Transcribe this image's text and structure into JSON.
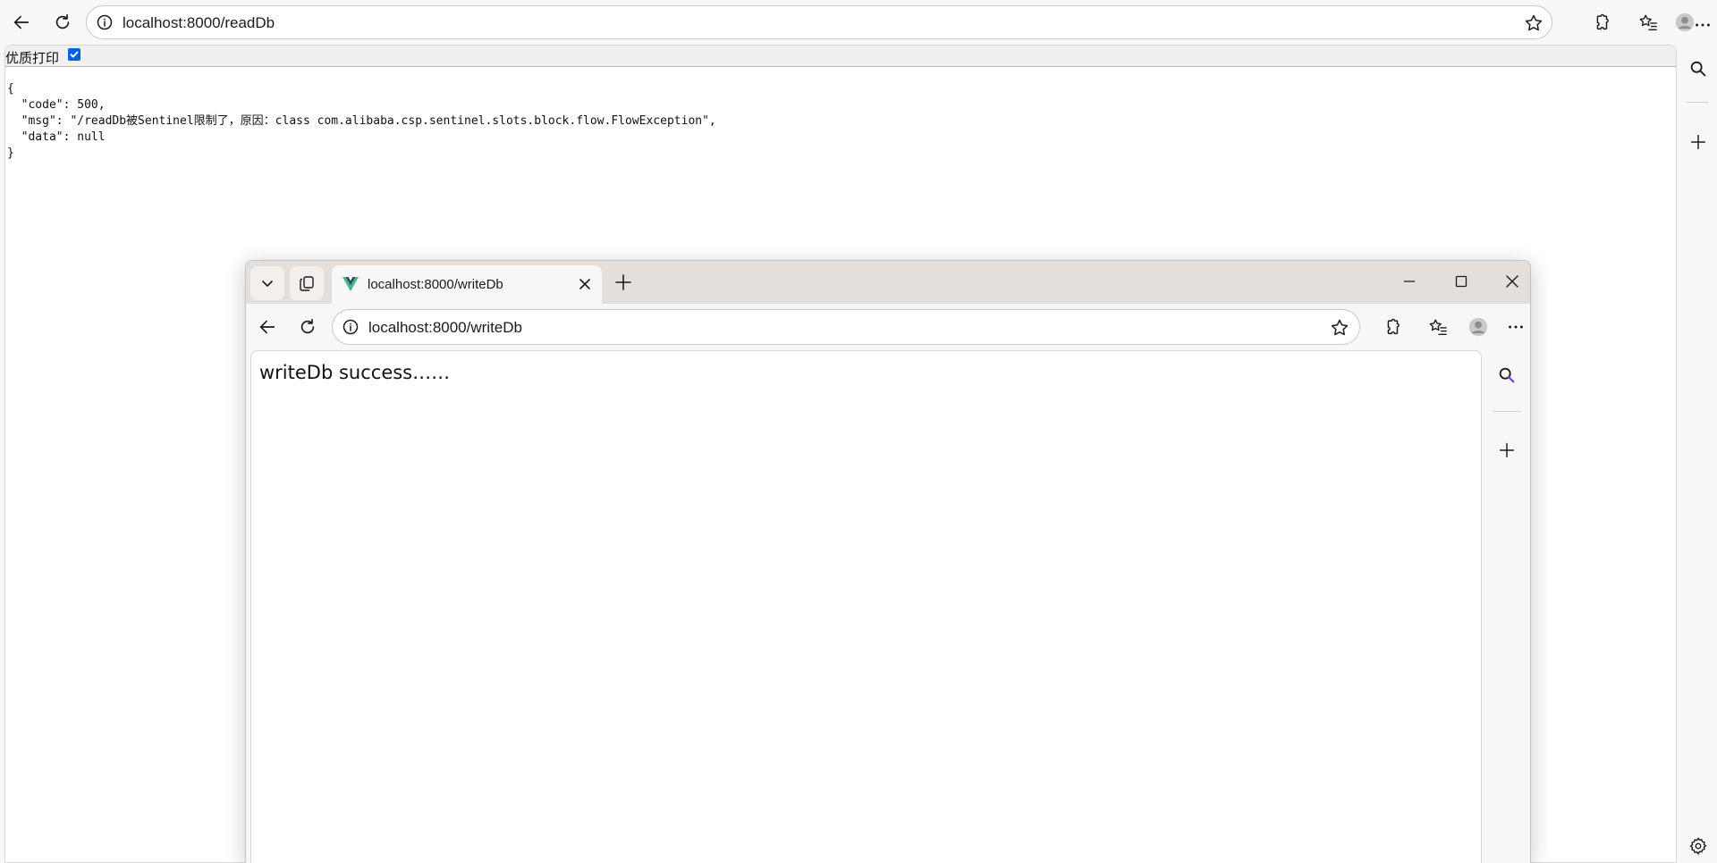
{
  "outer": {
    "address_url": "localhost:8000/readDb",
    "print_option_label": "优质打印",
    "print_option_checked": true,
    "response_text": "{\n  \"code\": 500,\n  \"msg\": \"/readDb被Sentinel限制了，原因：class com.alibaba.csp.sentinel.slots.block.flow.FlowException\",\n  \"data\": null\n}"
  },
  "inner": {
    "tab_title": "localhost:8000/writeDb",
    "address_url": "localhost:8000/writeDb",
    "page_text": "writeDb success……"
  },
  "colors": {
    "accent": "#0060df",
    "vue_green": "#41b883",
    "vue_dark": "#34495e",
    "tabstrip_bg": "#e4dfdb"
  }
}
